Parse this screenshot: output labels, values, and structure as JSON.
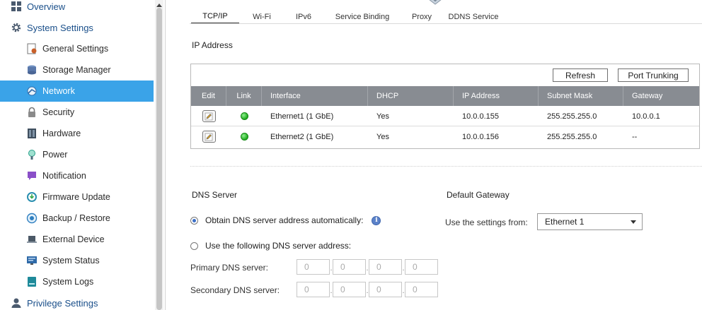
{
  "sidebar": {
    "top_items": [
      {
        "label": "Overview",
        "icon": "overview-icon"
      },
      {
        "label": "System Settings",
        "icon": "gear-icon"
      },
      {
        "label": "Privilege Settings",
        "icon": "user-icon"
      }
    ],
    "items": [
      {
        "label": "General Settings",
        "icon": "general-settings-icon"
      },
      {
        "label": "Storage Manager",
        "icon": "storage-icon"
      },
      {
        "label": "Network",
        "icon": "network-icon"
      },
      {
        "label": "Security",
        "icon": "lock-icon"
      },
      {
        "label": "Hardware",
        "icon": "hardware-icon"
      },
      {
        "label": "Power",
        "icon": "power-icon"
      },
      {
        "label": "Notification",
        "icon": "notification-icon"
      },
      {
        "label": "Firmware Update",
        "icon": "firmware-icon"
      },
      {
        "label": "Backup / Restore",
        "icon": "backup-icon"
      },
      {
        "label": "External Device",
        "icon": "laptop-icon"
      },
      {
        "label": "System Status",
        "icon": "monitor-icon"
      },
      {
        "label": "System Logs",
        "icon": "log-icon"
      }
    ],
    "active": "Network",
    "active_color": "#3aa3e8"
  },
  "tabs": [
    "TCP/IP",
    "Wi-Fi",
    "IPv6",
    "Service Binding",
    "Proxy",
    "DDNS Service"
  ],
  "active_tab": "TCP/IP",
  "ip_address": {
    "title": "IP Address",
    "refresh_label": "Refresh",
    "port_trunking_label": "Port Trunking",
    "columns": [
      "Edit",
      "Link",
      "Interface",
      "DHCP",
      "IP Address",
      "Subnet Mask",
      "Gateway"
    ],
    "rows": [
      {
        "interface": "Ethernet1 (1 GbE)",
        "dhcp": "Yes",
        "ip": "10.0.0.155",
        "mask": "255.255.255.0",
        "gateway": "10.0.0.1",
        "link": "up"
      },
      {
        "interface": "Ethernet2 (1 GbE)",
        "dhcp": "Yes",
        "ip": "10.0.0.156",
        "mask": "255.255.255.0",
        "gateway": "--",
        "link": "up"
      }
    ]
  },
  "dns": {
    "title": "DNS Server",
    "auto_label": "Obtain DNS server address automatically:",
    "manual_label": "Use the following DNS server address:",
    "selected": "auto",
    "primary_label": "Primary DNS server:",
    "secondary_label": "Secondary DNS server:",
    "primary": [
      "0",
      "0",
      "0",
      "0"
    ],
    "secondary": [
      "0",
      "0",
      "0",
      "0"
    ]
  },
  "gateway": {
    "title": "Default Gateway",
    "use_from_label": "Use the settings from:",
    "selected": "Ethernet 1"
  }
}
